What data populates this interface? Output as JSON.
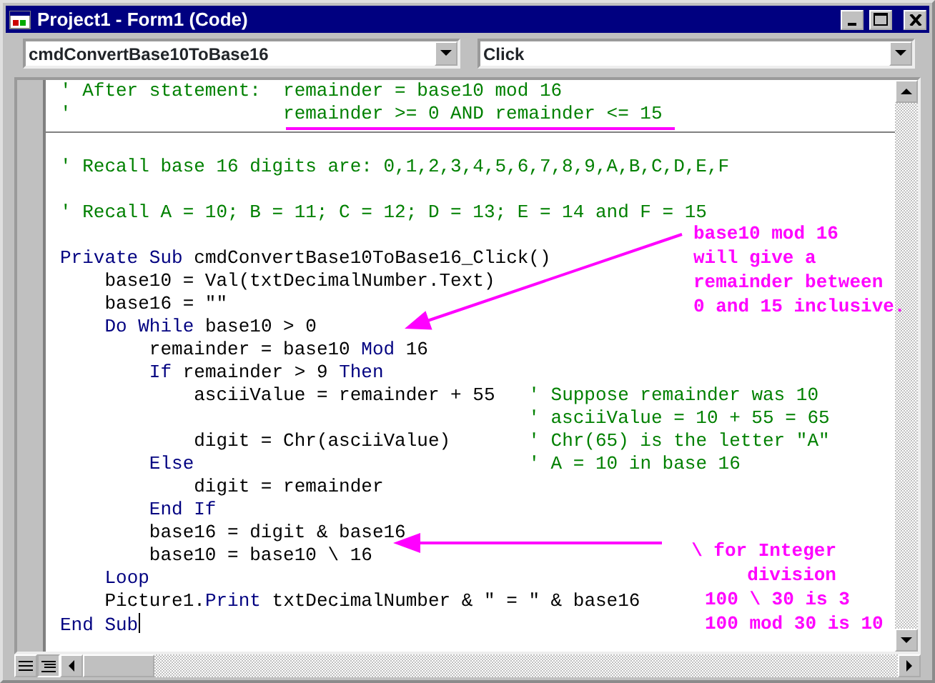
{
  "window": {
    "title": "Project1 - Form1 (Code)"
  },
  "object_box": {
    "value": "cmdConvertBase10ToBase16"
  },
  "procedure_box": {
    "value": "Click"
  },
  "code": {
    "declarations": [
      [
        {
          "kind": "comment",
          "text": "' After statement:  remainder = base10 mod 16"
        }
      ],
      [
        {
          "kind": "comment",
          "text": "'                   remainder >= 0 AND remainder <= 15"
        }
      ]
    ],
    "procedure": [
      {
        "blank_before": true,
        "segments": [
          {
            "kind": "comment",
            "text": "' Recall base 16 digits are: 0,1,2,3,4,5,6,7,8,9,A,B,C,D,E,F"
          }
        ]
      },
      {
        "blank_before": true,
        "segments": [
          {
            "kind": "comment",
            "text": "' Recall A = 10; B = 11; C = 12; D = 13; E = 14 and F = 15"
          }
        ]
      },
      {
        "blank_before": true,
        "segments": [
          {
            "kind": "keyword",
            "text": "Private Sub"
          },
          {
            "kind": "plain",
            "text": " cmdConvertBase10ToBase16_Click()"
          }
        ]
      },
      {
        "blank_before": false,
        "segments": [
          {
            "kind": "plain",
            "text": "    base10 = Val(txtDecimalNumber.Text)"
          }
        ]
      },
      {
        "blank_before": false,
        "segments": [
          {
            "kind": "plain",
            "text": "    base16 = \"\""
          }
        ]
      },
      {
        "blank_before": false,
        "segments": [
          {
            "kind": "keyword",
            "text": "    Do While"
          },
          {
            "kind": "plain",
            "text": " base10 > 0"
          }
        ]
      },
      {
        "blank_before": false,
        "segments": [
          {
            "kind": "plain",
            "text": "        remainder = base10 "
          },
          {
            "kind": "keyword",
            "text": "Mod"
          },
          {
            "kind": "plain",
            "text": " 16"
          }
        ]
      },
      {
        "blank_before": false,
        "segments": [
          {
            "kind": "keyword",
            "text": "        If"
          },
          {
            "kind": "plain",
            "text": " remainder > 9 "
          },
          {
            "kind": "keyword",
            "text": "Then"
          }
        ]
      },
      {
        "blank_before": false,
        "segments": [
          {
            "kind": "plain",
            "text": "            asciiValue = remainder + 55"
          },
          {
            "kind": "comment",
            "text": "   ' Suppose remainder was 10"
          }
        ]
      },
      {
        "blank_before": false,
        "segments": [
          {
            "kind": "comment",
            "text": "                                          ' asciiValue = 10 + 55 = 65"
          }
        ]
      },
      {
        "blank_before": false,
        "segments": [
          {
            "kind": "plain",
            "text": "            digit = Chr(asciiValue)"
          },
          {
            "kind": "comment",
            "text": "       ' Chr(65) is the letter \"A\""
          }
        ]
      },
      {
        "blank_before": false,
        "segments": [
          {
            "kind": "keyword",
            "text": "        Else"
          },
          {
            "kind": "comment",
            "text": "                              ' A = 10 in base 16"
          }
        ]
      },
      {
        "blank_before": false,
        "segments": [
          {
            "kind": "plain",
            "text": "            digit = remainder"
          }
        ]
      },
      {
        "blank_before": false,
        "segments": [
          {
            "kind": "keyword",
            "text": "        End If"
          }
        ]
      },
      {
        "blank_before": false,
        "segments": [
          {
            "kind": "plain",
            "text": "        base16 = digit & base16"
          }
        ]
      },
      {
        "blank_before": false,
        "segments": [
          {
            "kind": "plain",
            "text": "        base10 = base10 \\ 16"
          }
        ]
      },
      {
        "blank_before": false,
        "segments": [
          {
            "kind": "keyword",
            "text": "    Loop"
          }
        ]
      },
      {
        "blank_before": false,
        "segments": [
          {
            "kind": "plain",
            "text": "    Picture1."
          },
          {
            "kind": "keyword",
            "text": "Print"
          },
          {
            "kind": "plain",
            "text": " txtDecimalNumber & \" = \" & base16"
          }
        ]
      },
      {
        "blank_before": false,
        "segments": [
          {
            "kind": "keyword",
            "text": "End Sub"
          }
        ]
      }
    ]
  },
  "notes": [
    {
      "kind": "label",
      "lines": [
        "base10 mod 16",
        "will give a",
        "remainder between",
        "0 and 15 inclusive."
      ]
    },
    {
      "kind": "label-right",
      "lines": [
        "\\ for Integer",
        "division"
      ]
    },
    {
      "kind": "label",
      "lines": [
        "100 \\ 30 is 3",
        "100 mod 30 is 10"
      ]
    }
  ]
}
